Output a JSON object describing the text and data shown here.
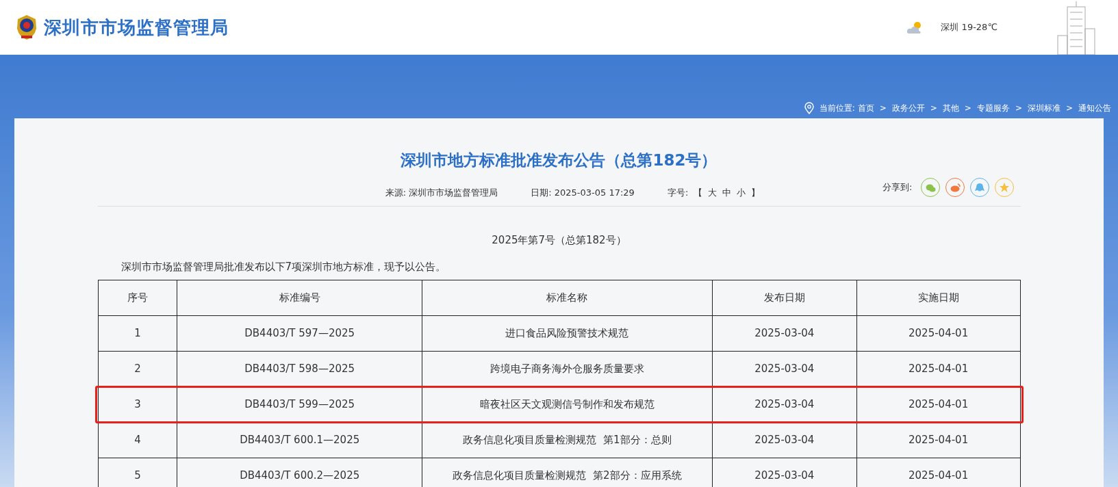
{
  "header": {
    "site_title": "深圳市市场监督管理局",
    "weather": "深圳 19-28℃"
  },
  "breadcrumb": {
    "label": "当前位置:",
    "items": [
      "首页",
      "政务公开",
      "其他",
      "专题服务",
      "深圳标准",
      "通知公告"
    ],
    "separator": ">"
  },
  "article": {
    "title": "深圳市地方标准批准发布公告（总第182号）",
    "meta": [
      {
        "label": "来源:",
        "value": "深圳市市场监督管理局"
      },
      {
        "label": "日期:",
        "value": "2025-03-05 17:29"
      }
    ],
    "font_size": {
      "label": "字号:",
      "open": "【",
      "options": [
        "大",
        "中",
        "小"
      ],
      "close": "】"
    },
    "share": {
      "label": "分享到:",
      "icons": [
        {
          "kind": "wechat",
          "color": "#8bc34a"
        },
        {
          "kind": "weibo",
          "color": "#f0793f"
        },
        {
          "kind": "qq",
          "color": "#5bb5e8"
        },
        {
          "kind": "favorite",
          "color": "#f5c040"
        }
      ]
    },
    "subtitle": "2025年第7号（总第182号）",
    "intro": "深圳市市场监督管理局批准发布以下7项深圳市地方标准，现予以公告。",
    "table": {
      "columns": [
        "序号",
        "标准编号",
        "标准名称",
        "发布日期",
        "实施日期"
      ],
      "rows": [
        {
          "cells": [
            "1",
            "DB4403/T 597—2025",
            "进口食品风险预警技术规范",
            "2025-03-04",
            "2025-04-01"
          ],
          "highlighted": false
        },
        {
          "cells": [
            "2",
            "DB4403/T 598—2025",
            "跨境电子商务海外仓服务质量要求",
            "2025-03-04",
            "2025-04-01"
          ],
          "highlighted": false
        },
        {
          "cells": [
            "3",
            "DB4403/T 599—2025",
            "暗夜社区天文观测信号制作和发布规范",
            "2025-03-04",
            "2025-04-01"
          ],
          "highlighted": true
        },
        {
          "cells": [
            "4",
            "DB4403/T 600.1—2025",
            "政务信息化项目质量检测规范  第1部分：总则",
            "2025-03-04",
            "2025-04-01"
          ],
          "highlighted": false
        },
        {
          "cells": [
            "5",
            "DB4403/T 600.2—2025",
            "政务信息化项目质量检测规范  第2部分：应用系统",
            "2025-03-04",
            "2025-04-01"
          ],
          "highlighted": false
        }
      ]
    }
  }
}
